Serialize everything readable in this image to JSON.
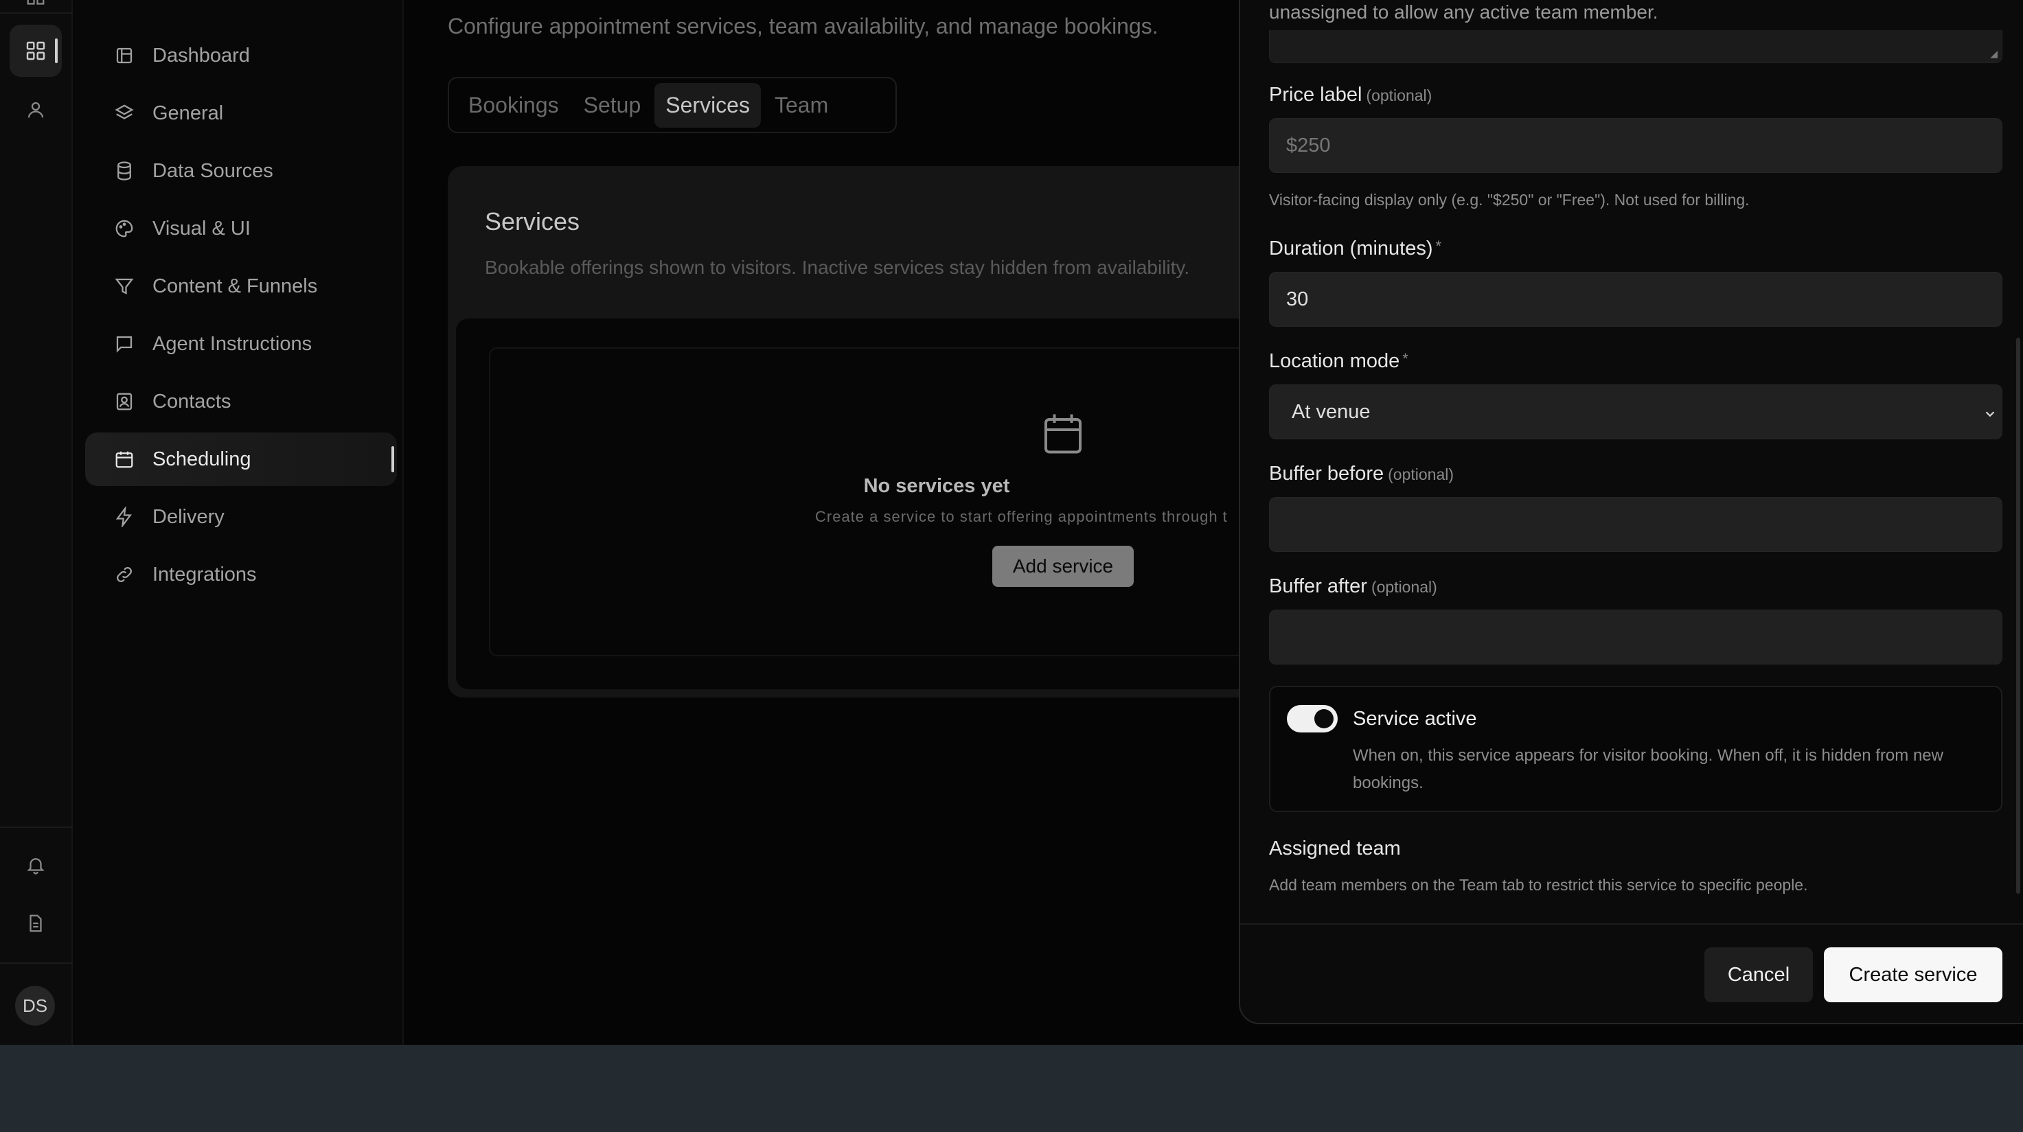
{
  "rail": {
    "avatar_initials": "DS",
    "icons": [
      "apps-grid-icon",
      "user-icon",
      "bell-icon",
      "document-icon"
    ]
  },
  "sidebar": {
    "items": [
      {
        "label": "Dashboard",
        "icon": "dashboard-icon"
      },
      {
        "label": "General",
        "icon": "layers-icon"
      },
      {
        "label": "Data Sources",
        "icon": "database-icon"
      },
      {
        "label": "Visual & UI",
        "icon": "palette-icon"
      },
      {
        "label": "Content & Funnels",
        "icon": "funnel-icon"
      },
      {
        "label": "Agent Instructions",
        "icon": "message-square-icon"
      },
      {
        "label": "Contacts",
        "icon": "contact-card-icon"
      },
      {
        "label": "Scheduling",
        "icon": "calendar-icon",
        "active": true
      },
      {
        "label": "Delivery",
        "icon": "lightning-icon"
      },
      {
        "label": "Integrations",
        "icon": "link-icon"
      }
    ]
  },
  "main": {
    "subtitle": "Configure appointment services, team availability, and manage bookings.",
    "tabs": [
      {
        "label": "Bookings"
      },
      {
        "label": "Setup"
      },
      {
        "label": "Services",
        "active": true
      },
      {
        "label": "Team"
      }
    ],
    "services": {
      "title": "Services",
      "description": "Bookable offerings shown to visitors. Inactive services stay hidden from availability.",
      "empty_title": "No services yet",
      "empty_description": "Create a service to start offering appointments through t",
      "add_button": "Add service"
    }
  },
  "drawer": {
    "top_help": "unassigned to allow any active team member.",
    "price": {
      "label": "Price label",
      "optional": "(optional)",
      "placeholder": "$250",
      "help": "Visitor-facing display only (e.g. \"$250\" or \"Free\"). Not used for billing."
    },
    "duration": {
      "label": "Duration (minutes)",
      "required": "*",
      "value": "30"
    },
    "location": {
      "label": "Location mode",
      "required": "*",
      "value": "At venue"
    },
    "buffer_before": {
      "label": "Buffer before",
      "optional": "(optional)",
      "value": ""
    },
    "buffer_after": {
      "label": "Buffer after",
      "optional": "(optional)",
      "value": ""
    },
    "service_active": {
      "title": "Service active",
      "on": true,
      "description": "When on, this service appears for visitor booking. When off, it is hidden from new bookings."
    },
    "assigned_team": {
      "title": "Assigned team",
      "help": "Add team members on the Team tab to restrict this service to specific people."
    },
    "cancel_label": "Cancel",
    "create_label": "Create service"
  }
}
